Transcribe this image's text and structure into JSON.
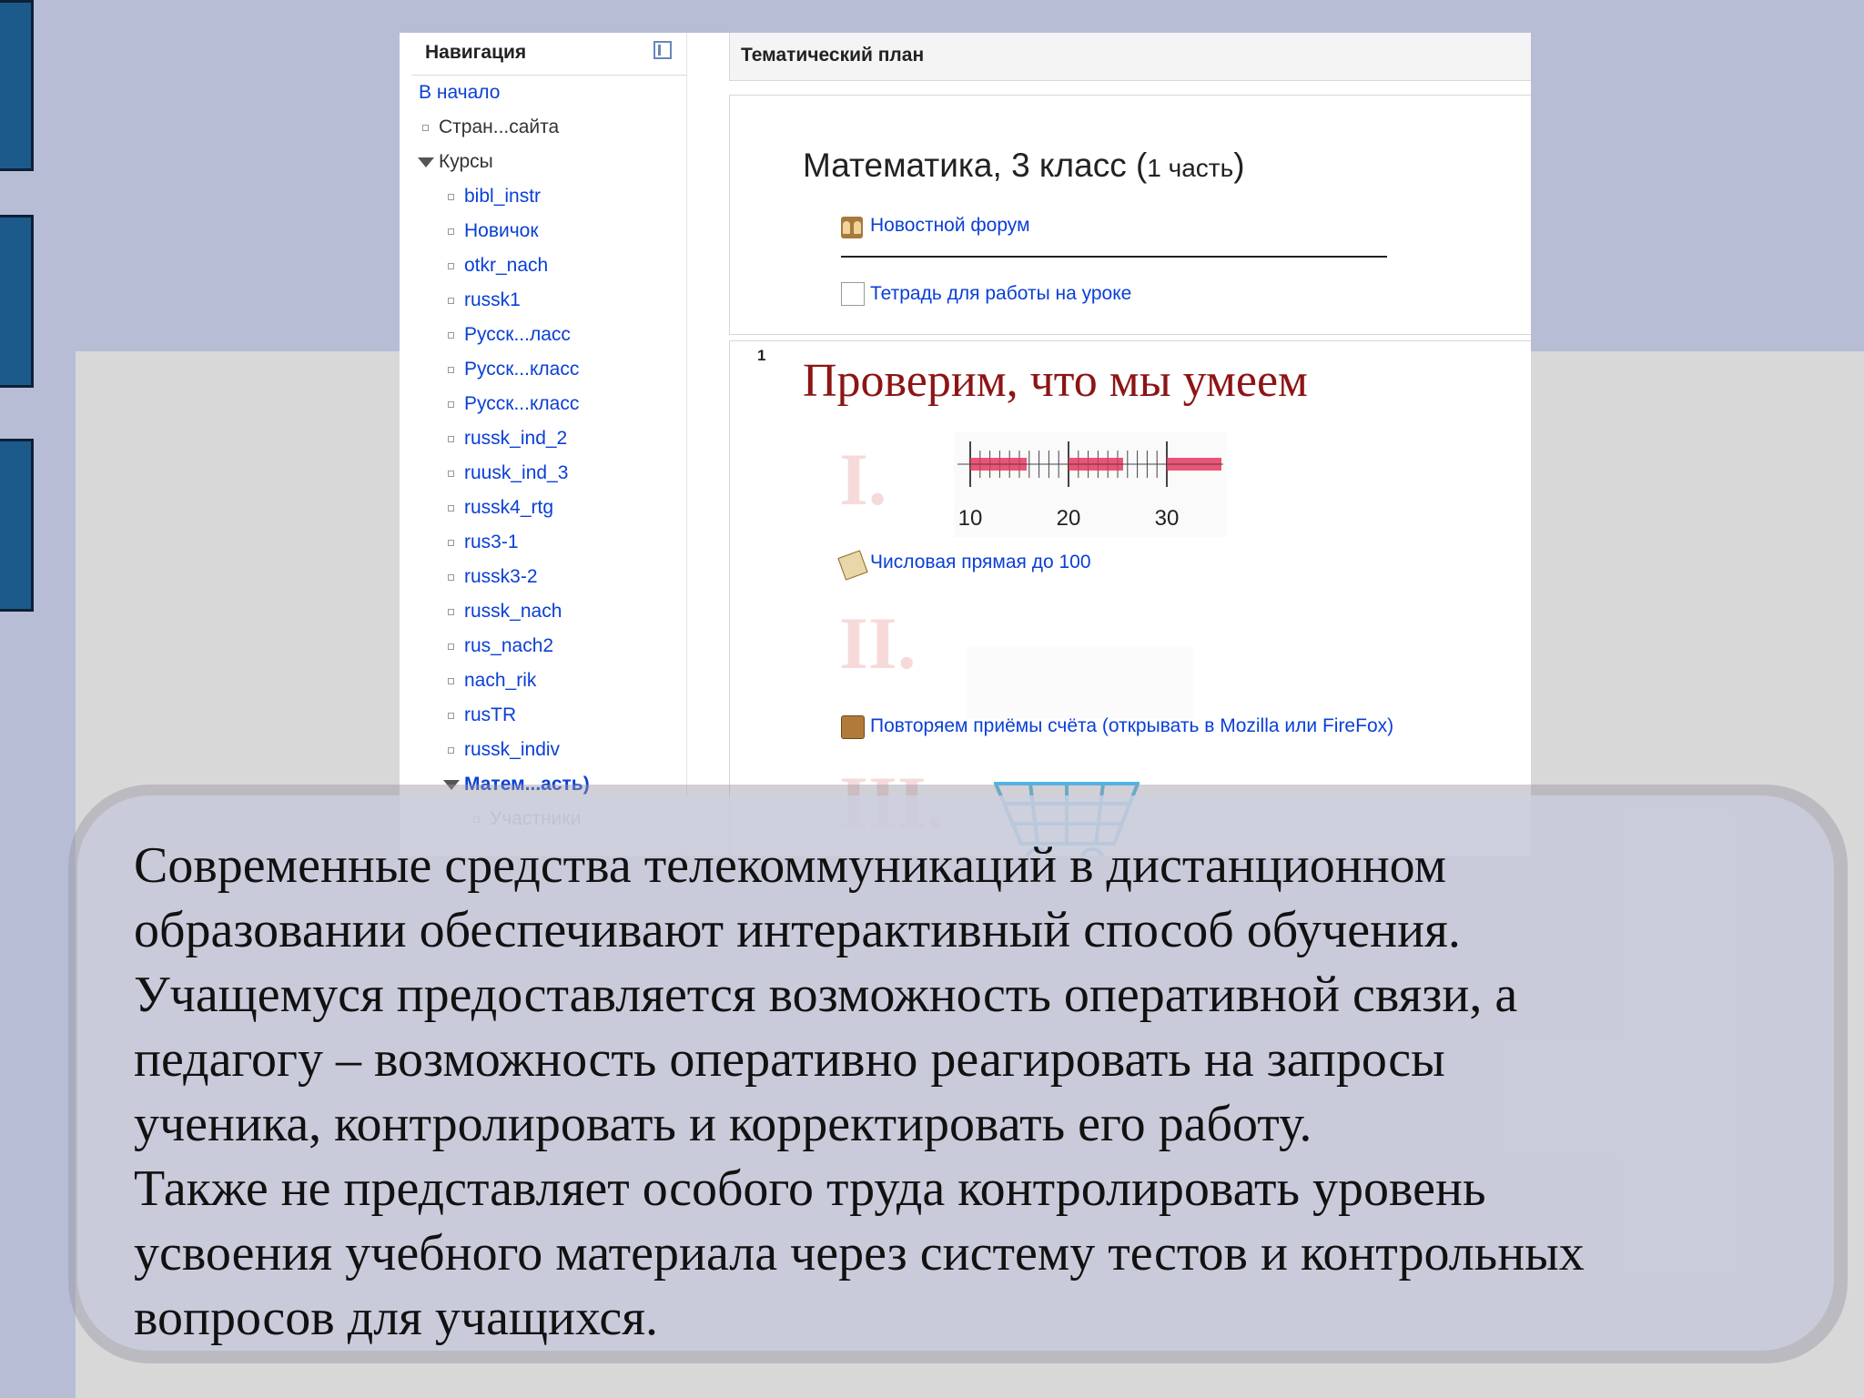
{
  "navigation": {
    "title": "Навигация",
    "items": [
      {
        "label": "В начало",
        "kind": "link",
        "level": 0,
        "marker": "none"
      },
      {
        "label": "Стран...сайта",
        "kind": "plain",
        "level": 1,
        "marker": "bullet"
      },
      {
        "label": "Курсы",
        "kind": "plain",
        "level": 1,
        "marker": "expanded"
      },
      {
        "label": "bibl_instr",
        "kind": "link",
        "level": 2,
        "marker": "bullet"
      },
      {
        "label": "Новичок",
        "kind": "link",
        "level": 2,
        "marker": "bullet"
      },
      {
        "label": "otkr_nach",
        "kind": "link",
        "level": 2,
        "marker": "bullet"
      },
      {
        "label": "russk1",
        "kind": "link",
        "level": 2,
        "marker": "bullet"
      },
      {
        "label": "Русск...ласс",
        "kind": "link",
        "level": 2,
        "marker": "bullet"
      },
      {
        "label": "Русск...класс",
        "kind": "link",
        "level": 2,
        "marker": "bullet"
      },
      {
        "label": "Русск...класс",
        "kind": "link",
        "level": 2,
        "marker": "bullet"
      },
      {
        "label": "russk_ind_2",
        "kind": "link",
        "level": 2,
        "marker": "bullet"
      },
      {
        "label": "ruusk_ind_3",
        "kind": "link",
        "level": 2,
        "marker": "bullet"
      },
      {
        "label": "russk4_rtg",
        "kind": "link",
        "level": 2,
        "marker": "bullet"
      },
      {
        "label": "rus3-1",
        "kind": "link",
        "level": 2,
        "marker": "bullet"
      },
      {
        "label": "russk3-2",
        "kind": "link",
        "level": 2,
        "marker": "bullet"
      },
      {
        "label": "russk_nach",
        "kind": "link",
        "level": 2,
        "marker": "bullet"
      },
      {
        "label": "rus_nach2",
        "kind": "link",
        "level": 2,
        "marker": "bullet"
      },
      {
        "label": "nach_rik",
        "kind": "link",
        "level": 2,
        "marker": "bullet"
      },
      {
        "label": "rusTR",
        "kind": "link",
        "level": 2,
        "marker": "bullet"
      },
      {
        "label": "russk_indiv",
        "kind": "link",
        "level": 2,
        "marker": "bullet"
      },
      {
        "label": "Матем...асть)",
        "kind": "current",
        "level": 2,
        "marker": "expanded"
      },
      {
        "label": "Участники",
        "kind": "dim",
        "level": 3,
        "marker": "bullet"
      }
    ]
  },
  "main": {
    "header_title": "Тематический план",
    "course_title": "Математика, 3 класс (",
    "course_title_part": "1 часть",
    "course_title_end": ")",
    "forum_link": "Новостной форум",
    "notebook_link": "Тетрадь для работы на уроке",
    "section_number": "1",
    "section_heading": "Проверим, что мы умеем",
    "roman_1": "I.",
    "roman_2": "II.",
    "roman_3": "III.",
    "ruler_labels": [
      "10",
      "20",
      "30"
    ],
    "number_line_link": "Числовая прямая до 100",
    "repeat_link": "Повторяем приёмы счёта (открывать в Mozilla или FireFox)"
  },
  "caption": {
    "lines": [
      "Современные средства телекоммуникаций в дистанционном",
      "образовании обеспечивают интерактивный способ обучения.",
      "Учащемуся предоставляется возможность оперативной связи, а",
      "педагогу – возможность оперативно реагировать на запросы",
      "ученика, контролировать и корректировать его работу.",
      "Также не представляет особого труда контролировать уровень",
      "усвоения учебного материала через систему тестов и контрольных",
      "вопросов для учащихся."
    ]
  },
  "colors": {
    "background": "#b8bdd6",
    "side_tabs": "#1d5a8c",
    "link": "#0a3fd6",
    "heading_red": "#8d1515"
  }
}
